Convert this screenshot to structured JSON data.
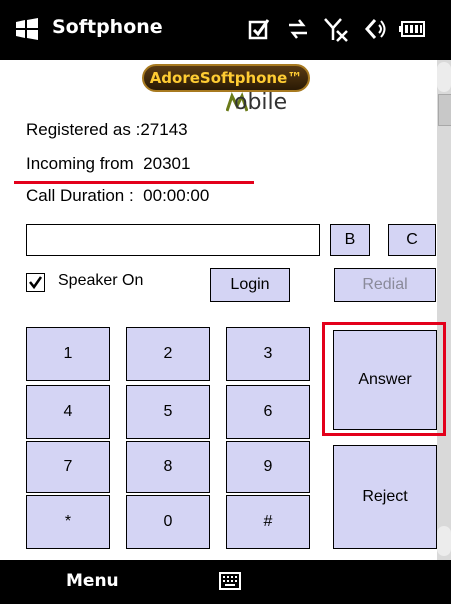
{
  "titlebar": {
    "app_title": "Softphone",
    "status_icons": [
      "checkbox-icon",
      "data-sync-icon",
      "no-signal-icon",
      "volume-icon",
      "battery-icon"
    ]
  },
  "logo": {
    "brand": "AdoreSoftphone™",
    "subtitle": "obile"
  },
  "info": {
    "registered_label": "Registered as :",
    "registered_value": "27143",
    "incoming_label": "Incoming from",
    "incoming_value": "20301",
    "duration_label": "Call Duration :",
    "duration_value": "00:00:00"
  },
  "controls": {
    "number_field_value": "",
    "b_label": "B",
    "c_label": "C",
    "speaker_label": "Speaker On",
    "speaker_checked": true,
    "login_label": "Login",
    "redial_label": "Redial"
  },
  "keypad": [
    "1",
    "2",
    "3",
    "4",
    "5",
    "6",
    "7",
    "8",
    "9",
    "*",
    "0",
    "#"
  ],
  "call_actions": {
    "answer_label": "Answer",
    "reject_label": "Reject"
  },
  "bottombar": {
    "menu_label": "Menu"
  },
  "colors": {
    "button_bg": "#d4d4f4",
    "highlight": "#e3001b",
    "logo_gold": "#ffcc33"
  }
}
